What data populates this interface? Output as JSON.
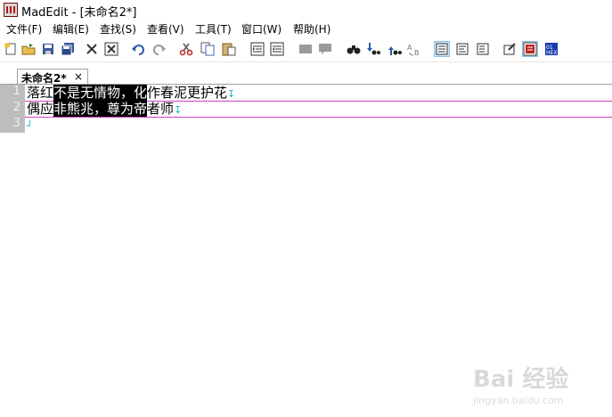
{
  "window": {
    "title": "MadEdit - [未命名2*]"
  },
  "menu": [
    "文件(F)",
    "编辑(E)",
    "查找(S)",
    "查看(V)",
    "工具(T)",
    "窗口(W)",
    "帮助(H)"
  ],
  "toolbar": {
    "buttons": [
      "new-file-icon",
      "open-file-icon",
      "save-icon",
      "save-all-icon",
      "close-icon",
      "close-all-icon",
      "undo-icon",
      "redo-icon",
      "cut-icon",
      "copy-icon",
      "paste-icon",
      "indent-icon",
      "unindent-icon",
      "comment-icon",
      "uncomment-icon",
      "find-icon",
      "find-next-icon",
      "find-prev-icon",
      "replace-icon",
      "no-wrap-icon",
      "wrap-by-window-icon",
      "wrap-by-column-icon",
      "text-mode-icon",
      "column-mode-icon",
      "hex-mode-icon"
    ],
    "active": [
      "no-wrap-icon",
      "column-mode-icon"
    ]
  },
  "tab": {
    "label": "未命名2*",
    "close": "×"
  },
  "editor": {
    "line_numbers": [
      "1",
      "2",
      "3"
    ],
    "lines": [
      {
        "before": "落红",
        "selected": "不是无情物，化",
        "after": "作春泥更护花"
      },
      {
        "before": "偶应",
        "selected": "非熊兆，尊为帝",
        "after": "者师"
      },
      {
        "before": "",
        "selected": "",
        "after": ""
      }
    ],
    "eol_marker": "↧",
    "eof_marker": "┘"
  },
  "watermark": {
    "text": "Bai 经验",
    "url": "jingyan.baidu.com"
  },
  "colors": {
    "selection_bg": "#000000",
    "gutter_bg": "#bdbdbd",
    "line_rule": "#d040c0",
    "eol": "#18b0c8"
  }
}
